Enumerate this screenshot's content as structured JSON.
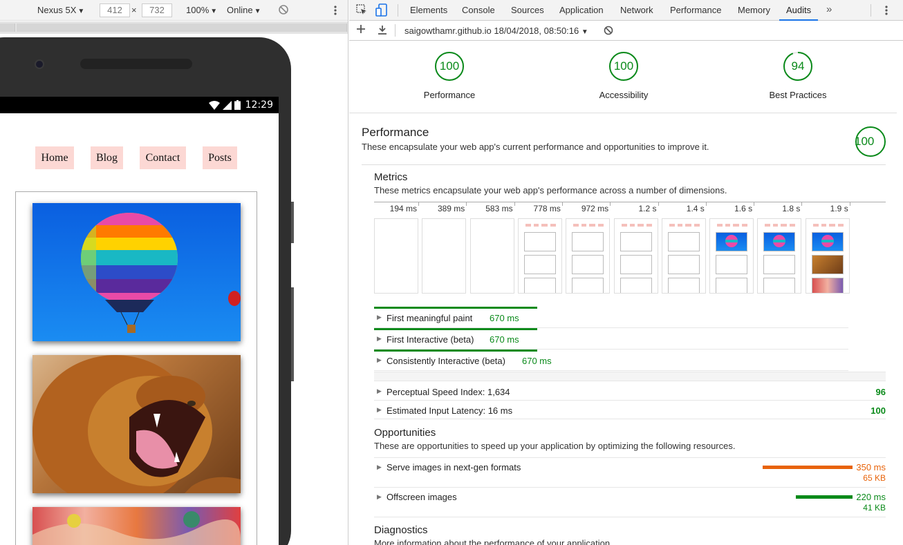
{
  "device_toolbar": {
    "device": "Nexus 5X",
    "width": "412",
    "height": "732",
    "times": "×",
    "zoom": "100%",
    "network": "Online"
  },
  "phone": {
    "time": "12:29"
  },
  "site": {
    "nav": [
      "Home",
      "Blog",
      "Contact",
      "Posts"
    ]
  },
  "devtools": {
    "tabs": [
      "Elements",
      "Console",
      "Sources",
      "Application",
      "Network",
      "Performance",
      "Memory",
      "Audits"
    ],
    "active_tab": "Audits",
    "audit_selector": "saigowthamr.github.io 18/04/2018, 08:50:16"
  },
  "scores": [
    {
      "value": "100",
      "label": "Performance",
      "fraction": 1.0
    },
    {
      "value": "100",
      "label": "Accessibility",
      "fraction": 1.0
    },
    {
      "value": "94",
      "label": "Best Practices",
      "fraction": 0.94
    }
  ],
  "performance": {
    "title": "Performance",
    "description": "These encapsulate your web app's current performance and opportunities to improve it.",
    "score": "100",
    "metrics": {
      "title": "Metrics",
      "description": "These metrics encapsulate your web app's performance across a number of dimensions.",
      "timeline_ticks": [
        "194 ms",
        "389 ms",
        "583 ms",
        "778 ms",
        "972 ms",
        "1.2 s",
        "1.4 s",
        "1.6 s",
        "1.8 s",
        "1.9 s"
      ],
      "items": [
        {
          "label": "First meaningful paint",
          "value": "670 ms"
        },
        {
          "label": "First Interactive (beta)",
          "value": "670 ms"
        },
        {
          "label": "Consistently Interactive (beta)",
          "value": "670 ms"
        }
      ],
      "extra": [
        {
          "label": "Perceptual Speed Index: 1,634",
          "score": "96"
        },
        {
          "label": "Estimated Input Latency: 16 ms",
          "score": "100"
        }
      ]
    },
    "opportunities": {
      "title": "Opportunities",
      "description": "These are opportunities to speed up your application by optimizing the following resources.",
      "items": [
        {
          "label": "Serve images in next-gen formats",
          "ms": "350 ms",
          "kb": "65 KB",
          "color": "#e8630a"
        },
        {
          "label": "Offscreen images",
          "ms": "220 ms",
          "kb": "41 KB",
          "color": "#0a8a1a"
        }
      ]
    },
    "diagnostics": {
      "title": "Diagnostics",
      "description": "More information about the performance of your application."
    }
  },
  "colors": {
    "pass": "#0a8a1a",
    "warn": "#e8630a",
    "accent": "#1a73e8",
    "nav_bg": "#fcd8d4"
  }
}
